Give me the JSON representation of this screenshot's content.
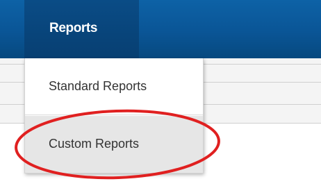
{
  "nav": {
    "active_tab": "Reports"
  },
  "dropdown": {
    "items": [
      {
        "label": "Standard Reports"
      },
      {
        "label": "Custom Reports",
        "highlighted": true
      }
    ]
  },
  "annotation": {
    "type": "ellipse",
    "color": "#e02020",
    "target": "Custom Reports"
  },
  "colors": {
    "navbar": "#0a5596",
    "active_tab": "#073f72",
    "hover_item": "#e6e6e6",
    "annotation": "#e02020"
  }
}
